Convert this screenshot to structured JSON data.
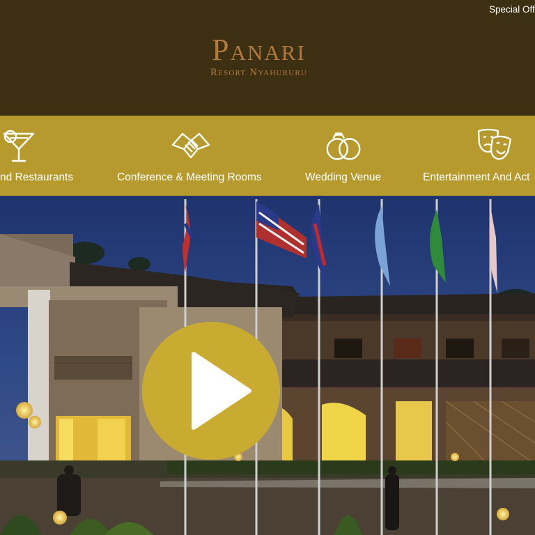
{
  "header": {
    "special_offers": "Special Off",
    "logo_title": "Panari",
    "logo_subtitle": "Resort Nyahururu"
  },
  "nav": {
    "items": [
      {
        "label": "nd Restaurants",
        "icon": "cocktail-icon"
      },
      {
        "label": "Conference & Meeting Rooms",
        "icon": "handshake-icon"
      },
      {
        "label": "Wedding Venue",
        "icon": "wedding-rings-icon"
      },
      {
        "label": "Entertainment And Act",
        "icon": "theater-masks-icon"
      }
    ]
  },
  "hero": {
    "play_icon": "play-icon",
    "colors": {
      "sky": "#2a3f7a",
      "play_button": "#c9ab31",
      "navbar": "#b79a2e",
      "header": "#3d2f12"
    }
  }
}
